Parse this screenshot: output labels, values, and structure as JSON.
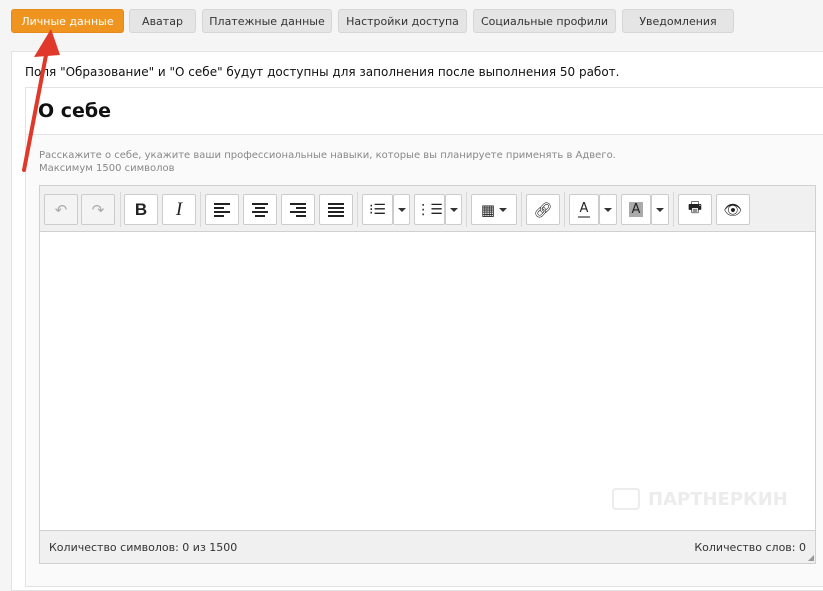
{
  "tabs": [
    {
      "label": "Личные данные",
      "active": true
    },
    {
      "label": "Аватар"
    },
    {
      "label": "Платежные данные"
    },
    {
      "label": "Настройки доступа"
    },
    {
      "label": "Социальные профили"
    },
    {
      "label": "Уведомления"
    }
  ],
  "notice": "Поля \"Образование\" и \"О себе\" будут доступны для заполнения после выполнения 50 работ.",
  "section": {
    "title": "О себе",
    "description": "Расскажите о себе, укажите ваши профессиональные навыки, которые вы планируете применять в Адвего.",
    "limit": "Максимум 1500 символов"
  },
  "editor": {
    "bold": "B",
    "italic": "I",
    "font_color": "A",
    "bg_color": "A",
    "char_count": "Количество символов: 0 из 1500",
    "word_count": "Количество слов: 0"
  },
  "watermark": "ПАРТНЕРКИН",
  "colors": {
    "accent": "#ef941e",
    "arrow": "#e0392b"
  }
}
